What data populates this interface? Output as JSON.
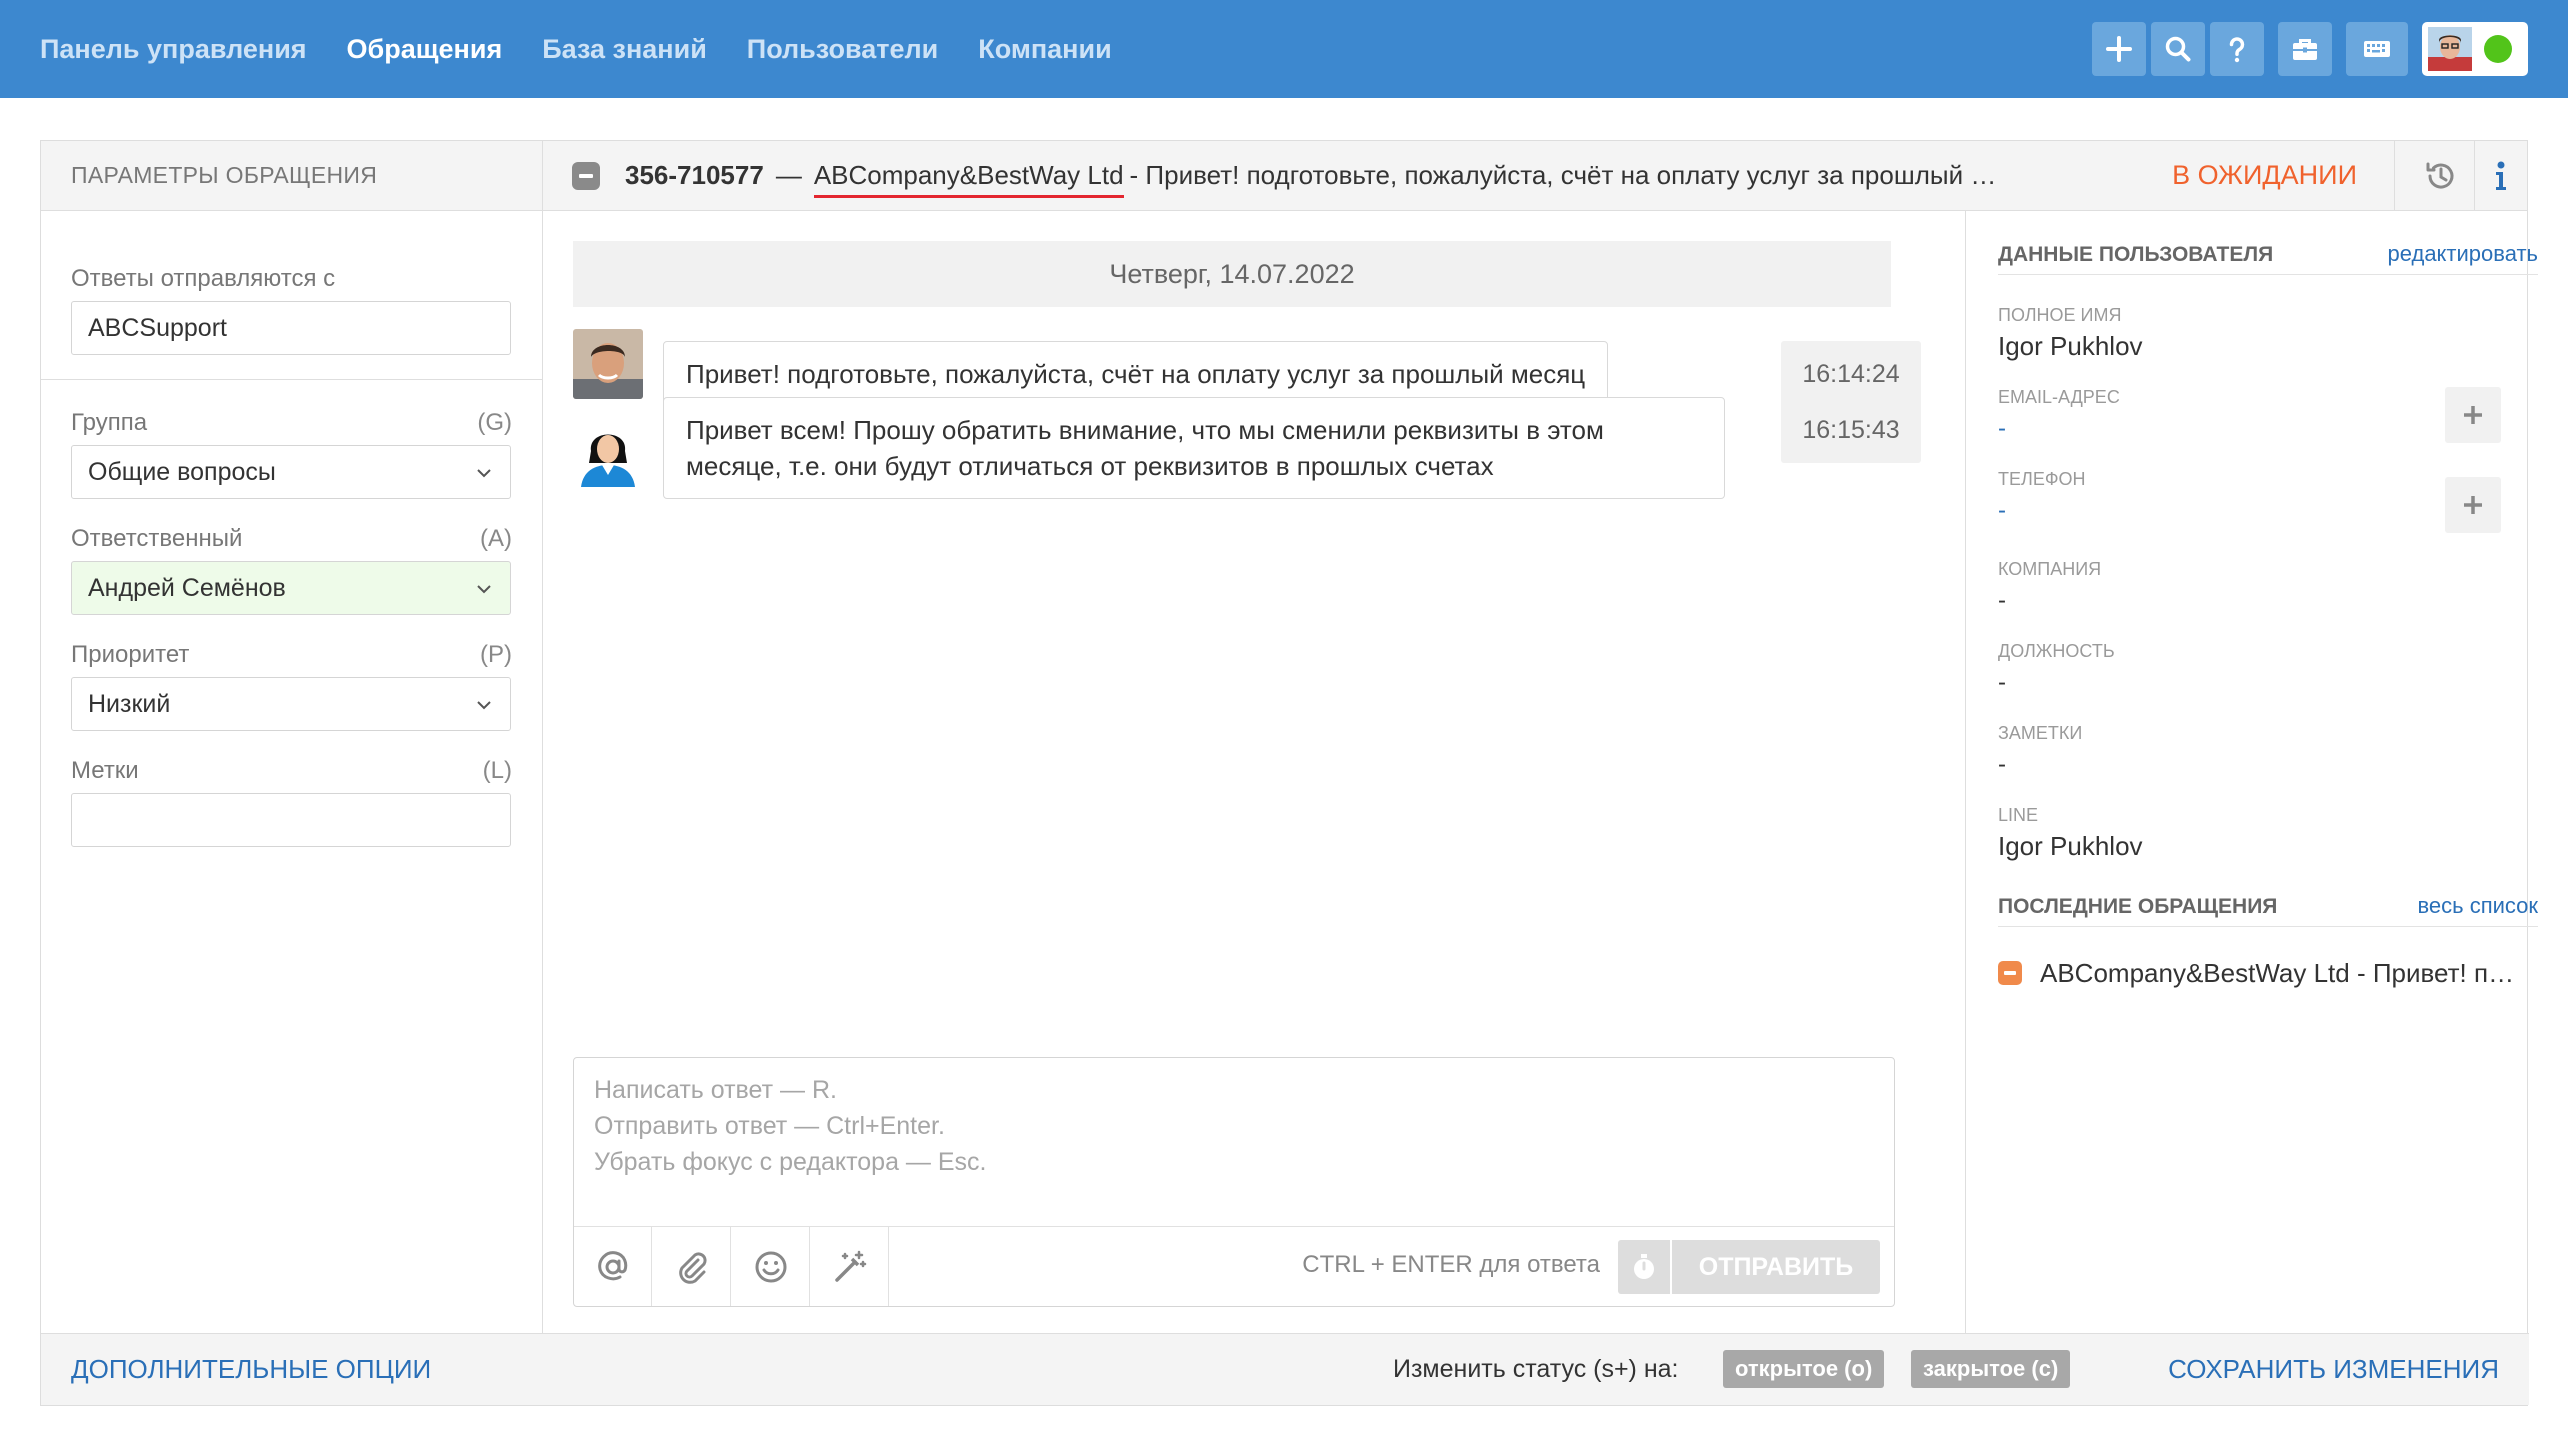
{
  "nav": {
    "items": [
      {
        "label": "Панель управления",
        "active": false
      },
      {
        "label": "Обращения",
        "active": true
      },
      {
        "label": "База знаний",
        "active": false
      },
      {
        "label": "Пользователи",
        "active": false
      },
      {
        "label": "Компании",
        "active": false
      }
    ],
    "tools": [
      "plus-icon",
      "search-icon",
      "help-icon",
      "briefcase-icon",
      "keyboard-icon"
    ],
    "user_status_color": "#52c41a"
  },
  "params": {
    "title": "ПАРАМЕТРЫ ОБРАЩЕНИЯ",
    "reply_from_label": "Ответы отправляются с",
    "reply_from_value": "ABCSupport",
    "group_label": "Группа",
    "group_key": "(G)",
    "group_value": "Общие вопросы",
    "assignee_label": "Ответственный",
    "assignee_key": "(A)",
    "assignee_value": "Андрей Семёнов",
    "priority_label": "Приоритет",
    "priority_key": "(P)",
    "priority_value": "Низкий",
    "tags_label": "Метки",
    "tags_key": "(L)",
    "tags_value": ""
  },
  "ticket": {
    "number": "356-710577",
    "dash": "—",
    "company": "ABCompany&BestWay Ltd",
    "subject": "- Привет! подготовьте, пожалуйста, счёт на оплату услуг за прошлый месяц",
    "status": "В ОЖИДАНИИ",
    "status_color": "#f0622d"
  },
  "chat": {
    "date": "Четверг, 14.07.2022",
    "messages": [
      {
        "author": "client",
        "text": "Привет! подготовьте, пожалуйста, счёт на оплату услуг за прошлый месяц",
        "time": "16:14:24"
      },
      {
        "author": "agent",
        "text": "Привет всем! Прошу обратить внимание, что мы сменили реквизиты в этом месяце, т.е. они будут отличаться от реквизитов в прошлых счетах",
        "time": "16:15:43"
      }
    ]
  },
  "editor": {
    "placeholder_lines": [
      "Написать ответ — R.",
      "Отправить ответ — Ctrl+Enter.",
      "Убрать фокус с редактора — Esc."
    ],
    "hint": "CTRL + ENTER для ответа",
    "send_label": "ОТПРАВИТЬ"
  },
  "user_panel": {
    "title": "ДАННЫЕ ПОЛЬЗОВАТЕЛЯ",
    "edit_link": "редактировать",
    "full_name_label": "ПОЛНОЕ ИМЯ",
    "full_name": "Igor Pukhlov",
    "email_label": "EMAIL-АДРЕС",
    "email": "-",
    "phone_label": "ТЕЛЕФОН",
    "phone": "-",
    "company_label": "КОМПАНИЯ",
    "company": "-",
    "position_label": "ДОЛЖНОСТЬ",
    "position": "-",
    "notes_label": "ЗАМЕТКИ",
    "notes": "-",
    "line_label": "LINE",
    "line": "Igor Pukhlov"
  },
  "recent": {
    "title": "ПОСЛЕДНИЕ ОБРАЩЕНИЯ",
    "all_link": "весь список",
    "items": [
      {
        "text": "ABCompany&BestWay Ltd - Привет! подготовьте, пожалуйста"
      }
    ]
  },
  "footer": {
    "more_options": "ДОПОЛНИТЕЛЬНЫЕ ОПЦИИ",
    "change_status": "Изменить статус (s+) на:",
    "open_btn": "открытое (o)",
    "closed_btn": "закрытое (c)",
    "save": "СОХРАНИТЬ ИЗМЕНЕНИЯ"
  }
}
